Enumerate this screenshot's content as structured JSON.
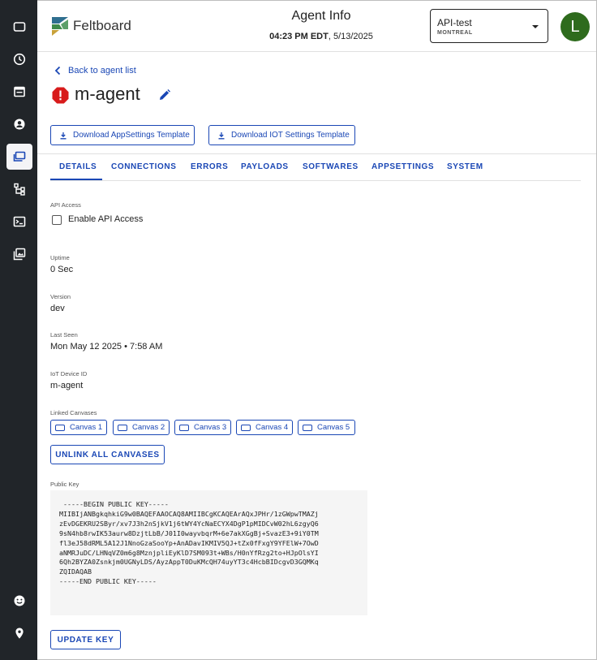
{
  "app": {
    "brand": "Feltboard",
    "page_title": "Agent Info"
  },
  "header": {
    "time_bold": "04:23 PM EDT",
    "time_rest": ", 5/13/2025",
    "selector": {
      "name": "API-test",
      "sub": "MONTREAL"
    },
    "avatar_initial": "L"
  },
  "sidebar": {
    "items": [
      "monitor-icon",
      "clock-icon",
      "calendar-icon",
      "account-icon",
      "canvases-icon",
      "hierarchy-icon",
      "terminal-icon",
      "media-icon",
      "support-icon",
      "location-icon"
    ],
    "active": "canvases-icon"
  },
  "agent": {
    "back_label": "Back to agent list",
    "name": "m-agent",
    "status_color": "#d81b1b"
  },
  "downloads": {
    "appsettings_label": "Download AppSettings Template",
    "iot_label": "Download IOT Settings Template"
  },
  "tabs": [
    "DETAILS",
    "CONNECTIONS",
    "ERRORS",
    "PAYLOADS",
    "SOFTWARES",
    "APPSETTINGS",
    "SYSTEM"
  ],
  "active_tab": "DETAILS",
  "details": {
    "api_access_label": "API Access",
    "enable_api_label": "Enable API Access",
    "enable_api_checked": false,
    "uptime_label": "Uptime",
    "uptime_value": "0 Sec",
    "version_label": "Version",
    "version_value": "dev",
    "last_seen_label": "Last Seen",
    "last_seen_value": "Mon May 12 2025 • 7:58 AM",
    "iot_id_label": "IoT Device ID",
    "iot_id_value": "m-agent",
    "linked_label": "Linked Canvases",
    "canvases": [
      "Canvas 1",
      "Canvas 2",
      "Canvas 3",
      "Canvas 4",
      "Canvas 5"
    ],
    "unlink_label": "UNLINK ALL CANVASES",
    "public_key_label": "Public Key",
    "public_key": " -----BEGIN PUBLIC KEY-----\nMIIBIjANBgkqhkiG9w0BAQEFAAOCAQ8AMIIBCgKCAQEArAQxJPHr/1zGWpwTMAZj\nzEvDGEKRU2SByr/xv7J3h2nSjkV1j6tWY4YcNaECYX4DgP1pMIDCvW02hL6zgyQ6\n9sN4hb8rwIK53aurw8DzjtLbB/J01I0wayvbqrM+6e7akXGgBj+SvazE3+9iY0TM\nfl3eJ58dRML5A12J1NnoGzaSooYp+AnADavIKMIV5QJ+tZx0fFxgY9YFElW+7OwD\naNMRJuDC/LHNqVZ0m6g8MznjpliEyKlD7SM093t+WBs/H0nYfRzg2to+HJpOlsYI\n6Qh2BYZA0Zsnkjm0UGNyLDS/AyzAppT0DuKMcQH74uyYT3c4HcbBIDcgvD3GQMKq\nZQIDAQAB\n-----END PUBLIC KEY-----",
    "update_key_label": "UPDATE KEY"
  },
  "colors": {
    "accent": "#1a47b5",
    "sidebar_bg": "#212529",
    "avatar_bg": "#2e6b1d"
  }
}
